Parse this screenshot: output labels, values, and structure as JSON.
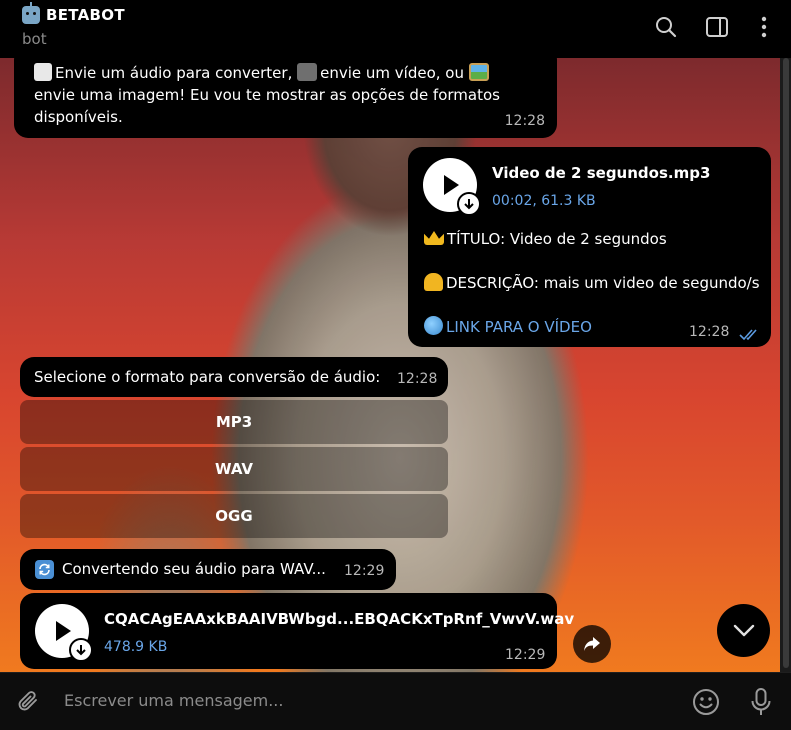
{
  "header": {
    "title": "BETABOT",
    "subtitle": "bot",
    "icons": [
      "search-icon",
      "sidebar-toggle-icon",
      "more-icon"
    ]
  },
  "messages": {
    "welcome": {
      "text": "Envie um áudio para converter, 🎥 envie um vídeo, ou 🖼 envie uma imagem! Eu vou te mostrar as opções de formatos disponíveis.",
      "line1": "Envie um áudio para converter,",
      "line1b": "envie um vídeo, ou",
      "line2": "envie uma imagem! Eu vou te mostrar as opções de formatos",
      "line3": "disponíveis.",
      "time": "12:28"
    },
    "video_audio": {
      "filename": "Video de 2 segundos.mp3",
      "meta": "00:02, 61.3 KB",
      "title_line": "TÍTULO: Video de 2 segundos",
      "desc_line": "DESCRIÇÃO: mais um video de segundo/s",
      "link_line": "LINK PARA O VÍDEO",
      "time": "12:28"
    },
    "select_format": {
      "text": "Selecione o formato para conversão de áudio:",
      "time": "12:28",
      "buttons": [
        "MP3",
        "WAV",
        "OGG"
      ]
    },
    "converting": {
      "text": "Convertendo seu áudio para WAV...",
      "time": "12:29"
    },
    "wav_file": {
      "filename": "CQACAgEAAxkBAAIVBWbgd...EBQACKxTpRnf_VwvV.wav",
      "size": "478.9 KB",
      "time": "12:29"
    }
  },
  "compose": {
    "placeholder": "Escrever uma mensagem..."
  },
  "colors": {
    "accent_link": "#6aa6e8",
    "bubble": "#000000",
    "meta_blue": "#6aa6e8",
    "read_check": "#5b9be0"
  }
}
